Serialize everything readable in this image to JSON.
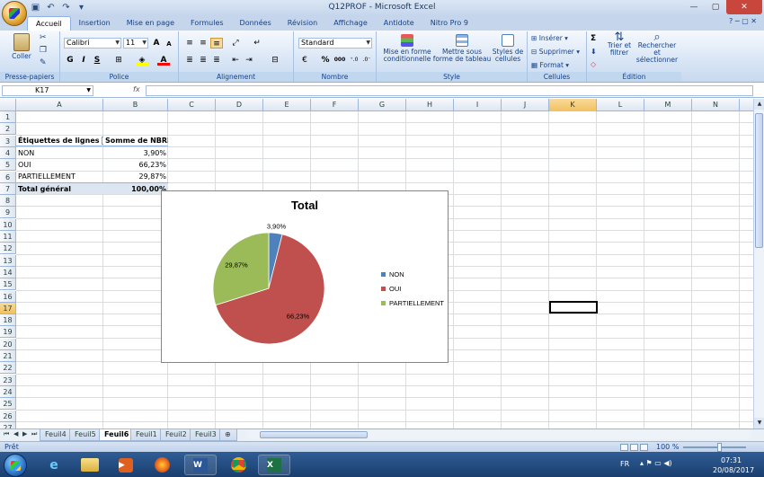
{
  "window": {
    "title": "Q12PROF - Microsoft Excel"
  },
  "ribbon": {
    "tabs": [
      "Accueil",
      "Insertion",
      "Mise en page",
      "Formules",
      "Données",
      "Révision",
      "Affichage",
      "Antidote",
      "Nitro Pro 9"
    ],
    "active_tab": "Accueil",
    "clipboard": {
      "paste": "Coller",
      "label": "Presse-papiers"
    },
    "font": {
      "name": "Calibri",
      "size": "11",
      "bold": "G",
      "italic": "I",
      "underline": "S",
      "label": "Police"
    },
    "alignment": {
      "label": "Alignement"
    },
    "number": {
      "format": "Standard",
      "percent": "%",
      "thousands": "000",
      "label": "Nombre"
    },
    "styles": {
      "conditional": "Mise en forme conditionnelle",
      "table": "Mettre sous forme de tableau",
      "cell_styles": "Styles de cellules",
      "label": "Style"
    },
    "cells": {
      "insert": "Insérer",
      "delete": "Supprimer",
      "format": "Format",
      "label": "Cellules"
    },
    "editing": {
      "sum": "Σ",
      "sort": "Trier et filtrer",
      "find": "Rechercher et sélectionner",
      "label": "Édition"
    }
  },
  "formula_bar": {
    "name_box": "K17",
    "fx": "fx",
    "value": ""
  },
  "columns": [
    "A",
    "B",
    "C",
    "D",
    "E",
    "F",
    "G",
    "H",
    "I",
    "J",
    "K",
    "L",
    "M",
    "N"
  ],
  "rows": [
    "1",
    "2",
    "3",
    "4",
    "5",
    "6",
    "7",
    "8",
    "9",
    "10",
    "11",
    "12",
    "13",
    "14",
    "15",
    "16",
    "17",
    "18",
    "19",
    "20",
    "21",
    "22",
    "23",
    "24",
    "25",
    "26",
    "27"
  ],
  "selected": {
    "col": "K",
    "row": "17"
  },
  "pivot": {
    "header_label": "Étiquettes de lignes",
    "header_value": "Somme de NBRE",
    "rows": [
      {
        "label": "NON",
        "value": "3,90%"
      },
      {
        "label": "OUI",
        "value": "66,23%"
      },
      {
        "label": "PARTIELLEMENT",
        "value": "29,87%"
      }
    ],
    "total_label": "Total général",
    "total_value": "100,00%"
  },
  "chart_data": {
    "type": "pie",
    "title": "Total",
    "categories": [
      "NON",
      "OUI",
      "PARTIELLEMENT"
    ],
    "values": [
      3.9,
      66.23,
      29.87
    ],
    "data_labels": [
      "3,90%",
      "66,23%",
      "29,87%"
    ],
    "colors": [
      "#4f81bd",
      "#c0504d",
      "#9bbb59"
    ],
    "legend": "right"
  },
  "sheets": {
    "tabs": [
      "Feuil4",
      "Feuil5",
      "Feuil6",
      "Feuil1",
      "Feuil2",
      "Feuil3"
    ],
    "active": "Feuil6"
  },
  "status": {
    "ready": "Prêt",
    "zoom": "100 %"
  },
  "taskbar": {
    "lang": "FR",
    "time": "07:31",
    "date": "20/08/2017"
  }
}
